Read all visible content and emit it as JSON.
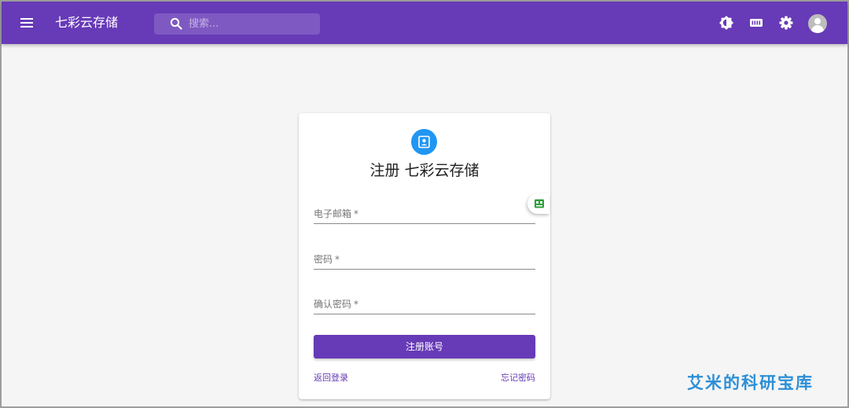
{
  "appbar": {
    "title": "七彩云存储",
    "search": {
      "placeholder": "搜索..."
    },
    "icons": {
      "menu": "menu-icon",
      "search": "search-icon",
      "theme": "theme-toggle-icon",
      "storage": "storage-icon",
      "settings": "gear-icon",
      "avatar": "account-icon"
    }
  },
  "register_card": {
    "icon": "contact-badge-icon",
    "title": "注册 七彩云存储",
    "fields": [
      {
        "label": "电子邮箱",
        "required_mark": "*"
      },
      {
        "label": "密码",
        "required_mark": "*"
      },
      {
        "label": "确认密码",
        "required_mark": "*"
      }
    ],
    "submit_label": "注册账号",
    "back_link": "返回登录",
    "forgot_link": "忘记密码"
  },
  "floating_tab": {
    "icon": "id-card-icon"
  },
  "watermark": "艾米的科研宝库",
  "colors": {
    "primary": "#673ab7",
    "badge": "#2196f3",
    "watermark": "#2d8fd6",
    "background": "#f5f5f5"
  }
}
